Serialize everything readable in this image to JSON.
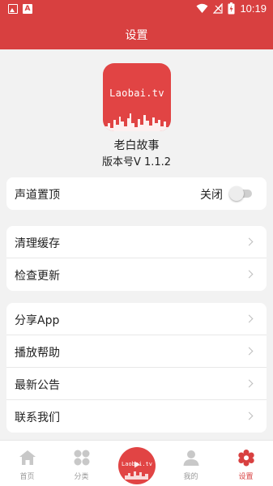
{
  "status_bar": {
    "time": "10:19",
    "left_icons": [
      "image-icon",
      "a-icon"
    ],
    "right_icons": [
      "wifi-icon",
      "signal-icon",
      "battery-icon"
    ],
    "a_glyph": "A"
  },
  "app_bar": {
    "title": "设置"
  },
  "header": {
    "logo_text": "Laobai.tv",
    "app_name": "老白故事",
    "version": "版本号V 1.1.2"
  },
  "groups": [
    {
      "items": [
        {
          "label": "声道置顶",
          "toggle_text": "关闭",
          "toggle_on": false
        }
      ]
    },
    {
      "items": [
        {
          "label": "清理缓存"
        },
        {
          "label": "检查更新"
        }
      ]
    },
    {
      "items": [
        {
          "label": "分享App"
        },
        {
          "label": "播放帮助"
        },
        {
          "label": "最新公告"
        },
        {
          "label": "联系我们"
        }
      ]
    }
  ],
  "tabs": [
    {
      "label": "首页",
      "icon": "home-icon",
      "active": false
    },
    {
      "label": "分类",
      "icon": "category-icon",
      "active": false
    },
    {
      "label": "",
      "icon": "play-logo-icon",
      "center_text": "Laobai.tv",
      "active": false
    },
    {
      "label": "我的",
      "icon": "user-icon",
      "active": false
    },
    {
      "label": "设置",
      "icon": "settings-icon",
      "active": true
    }
  ],
  "colors": {
    "primary": "#d84040",
    "background": "#f2f2f2",
    "inactive": "#c8c8c8"
  }
}
